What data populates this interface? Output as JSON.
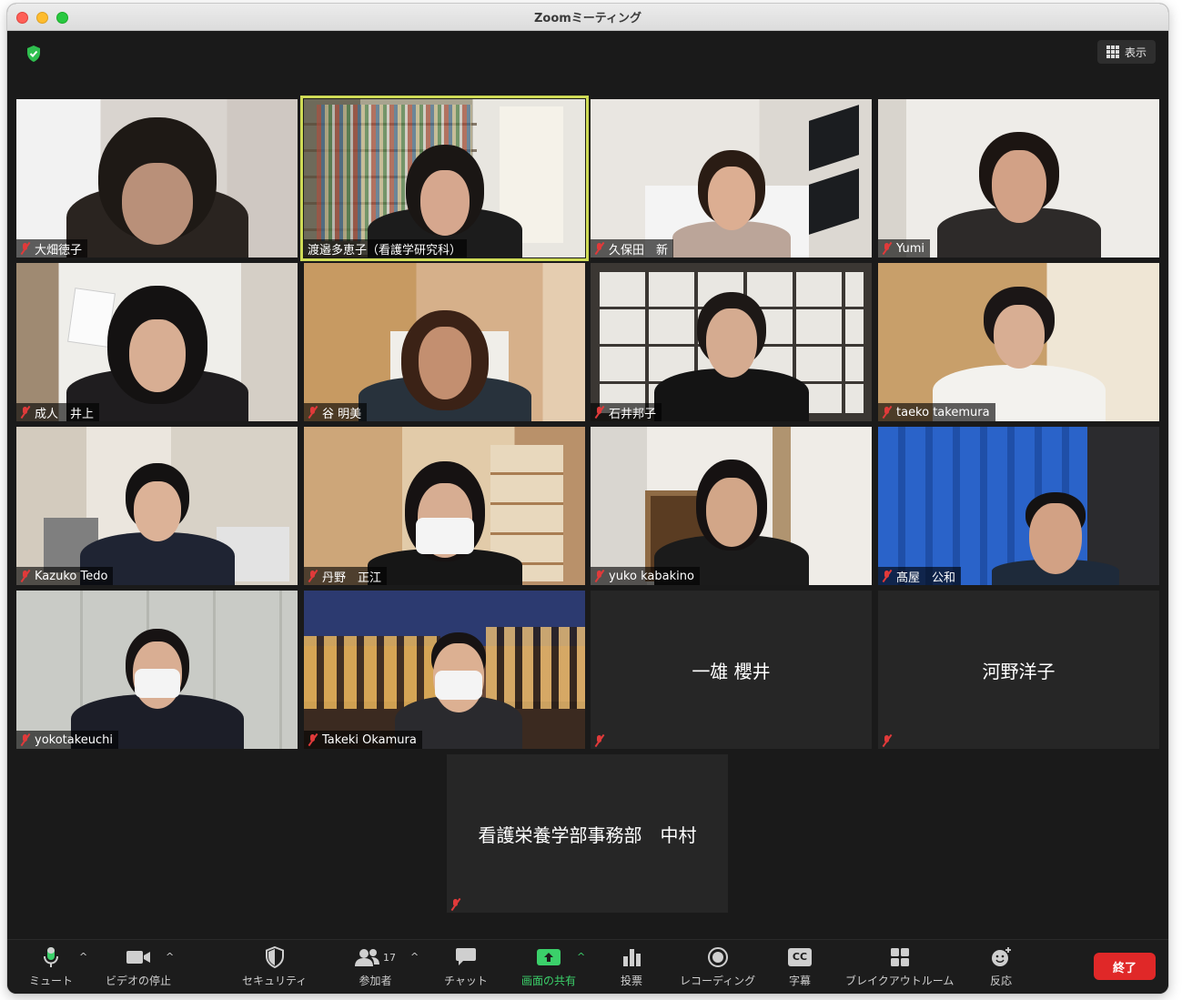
{
  "window": {
    "title": "Zoomミーティング"
  },
  "header": {
    "view_label": "表示"
  },
  "participants": [
    {
      "name": "大畑徳子"
    },
    {
      "name": "渡邉多恵子（看護学研究科）"
    },
    {
      "name": "久保田　新"
    },
    {
      "name": "Yumi"
    },
    {
      "name": "成人　井上"
    },
    {
      "name": "谷 明美"
    },
    {
      "name": "石井邦子"
    },
    {
      "name": "taeko takemura"
    },
    {
      "name": "Kazuko Tedo"
    },
    {
      "name": "丹野　正江"
    },
    {
      "name": "yuko kabakino"
    },
    {
      "name": "髙屋　公和"
    },
    {
      "name": "yokotakeuchi"
    },
    {
      "name": "Takeki Okamura"
    },
    {
      "name": "一雄 櫻井"
    },
    {
      "name": "河野洋子"
    },
    {
      "name": "看護栄養学部事務部　中村"
    }
  ],
  "toolbar": {
    "mute": "ミュート",
    "video": "ビデオの停止",
    "security": "セキュリティ",
    "participants": "参加者",
    "participants_count": "17",
    "chat": "チャット",
    "share": "画面の共有",
    "polls": "投票",
    "record": "レコーディング",
    "cc": "字幕",
    "cc_badge": "CC",
    "breakout": "ブレイクアウトルーム",
    "reactions": "反応",
    "end": "終了"
  },
  "colors": {
    "active_speaker_border": "#cfdb56",
    "share_green": "#3bd06a",
    "end_red": "#e02828",
    "muted_red": "#e03a3a"
  }
}
